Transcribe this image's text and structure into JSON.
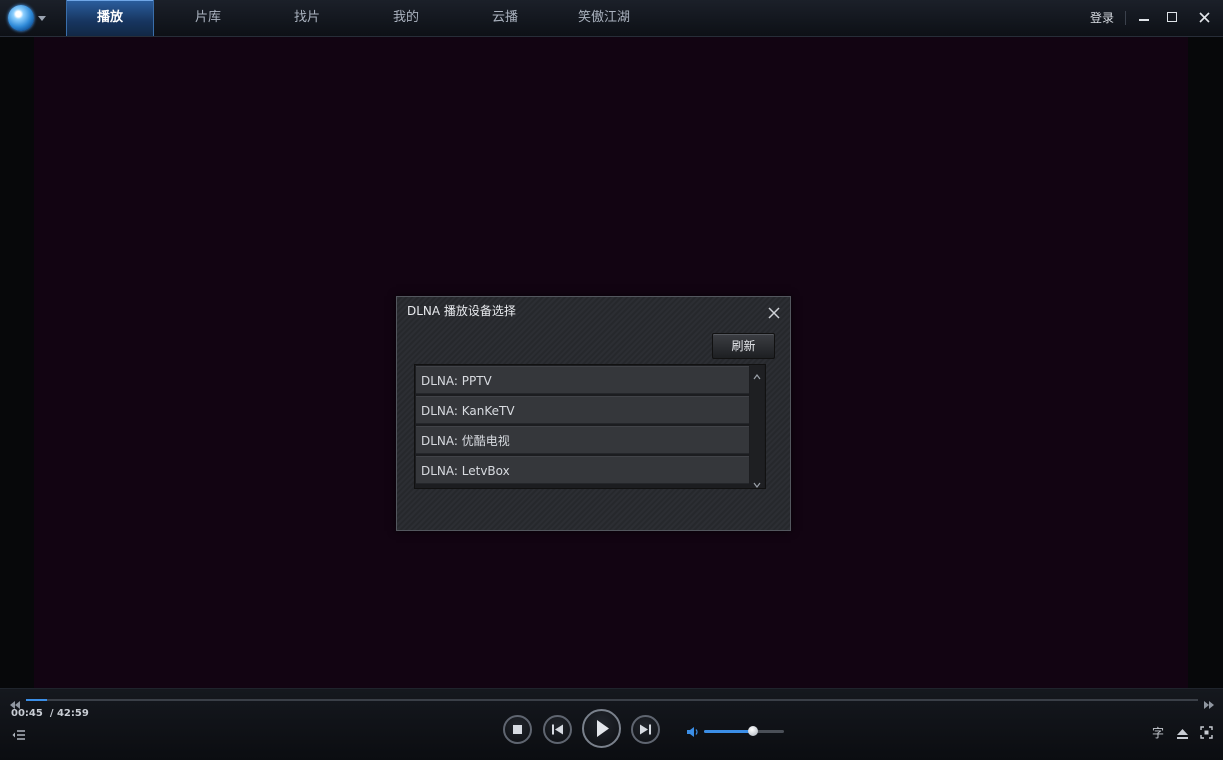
{
  "nav": {
    "tabs": [
      {
        "label": "播放",
        "active": true
      },
      {
        "label": "片库",
        "active": false
      },
      {
        "label": "找片",
        "active": false
      },
      {
        "label": "我的",
        "active": false
      },
      {
        "label": "云播",
        "active": false
      },
      {
        "label": "笑傲江湖",
        "active": false
      }
    ],
    "login_label": "登录"
  },
  "dialog": {
    "title": "DLNA 播放设备选择",
    "refresh_label": "刷新",
    "devices": [
      "DLNA: PPTV",
      "DLNA: KanKeTV",
      "DLNA: 优酷电视",
      "DLNA: LetvBox"
    ]
  },
  "player": {
    "current_time": "00:45",
    "total_time": "/ 42:59",
    "progress_fraction": 0.018,
    "volume_fraction": 0.6,
    "subtitle_glyph": "字"
  },
  "colors": {
    "accent": "#3b8ee6",
    "video_bg": "#120412"
  },
  "icons": [
    "app-logo-icon",
    "minimize-icon",
    "maximize-icon",
    "close-icon",
    "rewind-icon",
    "fast-forward-icon",
    "playlist-icon",
    "stop-icon",
    "previous-icon",
    "play-icon",
    "next-icon",
    "volume-icon",
    "eject-icon",
    "fullscreen-icon"
  ]
}
